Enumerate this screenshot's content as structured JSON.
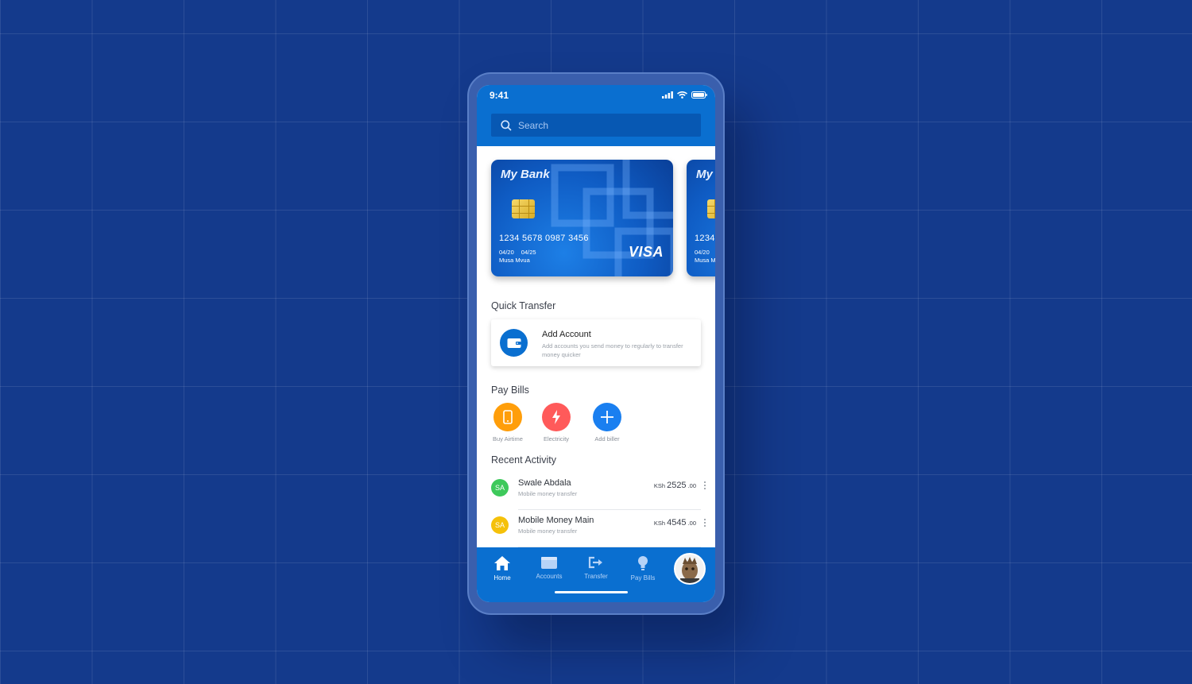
{
  "status_bar": {
    "time": "9:41"
  },
  "search": {
    "placeholder": "Search"
  },
  "cards": [
    {
      "bank_name": "My Bank",
      "number": "1234 5678 0987 3456",
      "valid_from": "04/20",
      "valid_thru": "04/25",
      "holder": "Musa Mvua",
      "network": "VISA"
    },
    {
      "bank_name": "My",
      "number": "1234",
      "valid_from": "04/20",
      "holder": "Musa M"
    }
  ],
  "quick_transfer": {
    "title": "Quick Transfer",
    "add_account": {
      "title": "Add Account",
      "description": "Add accounts you send money to regularly to transfer money quicker"
    }
  },
  "pay_bills": {
    "title": "Pay Bills",
    "items": [
      {
        "label": "Buy Airtime",
        "icon": "phone-icon"
      },
      {
        "label": "Electricity",
        "icon": "lightning-icon"
      },
      {
        "label": "Add biller",
        "icon": "plus-icon"
      }
    ]
  },
  "recent_activity": {
    "title": "Recent Activity",
    "items": [
      {
        "initials": "SA",
        "name": "Swale Abdala",
        "type": "Mobile money transfer",
        "currency": "KSh",
        "amount": "2525",
        "cents": ".00"
      },
      {
        "initials": "SA",
        "name": "Mobile Money Main",
        "type": "Mobile money transfer",
        "currency": "KSh",
        "amount": "4545",
        "cents": ".00"
      }
    ]
  },
  "nav": {
    "items": [
      {
        "label": "Home",
        "icon": "home-icon",
        "active": true
      },
      {
        "label": "Accounts",
        "icon": "wallet-icon"
      },
      {
        "label": "Transfer",
        "icon": "transfer-icon"
      },
      {
        "label": "Pay Bills",
        "icon": "lightbulb-icon"
      }
    ]
  },
  "colors": {
    "background": "#143a8c",
    "primary": "#0a6fd0",
    "airtime": "#ff9e0a",
    "electricity": "#ff5a5a",
    "add_biller": "#1a7ff0"
  }
}
